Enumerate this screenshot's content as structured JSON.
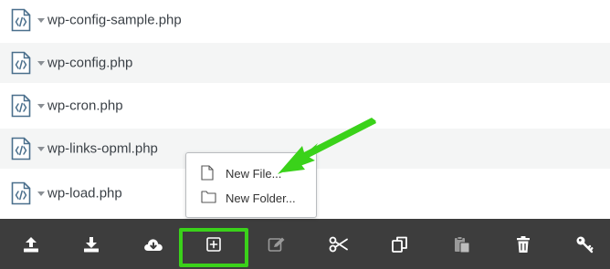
{
  "files": [
    {
      "name": "wp-config-sample.php",
      "icon": "php-file-icon"
    },
    {
      "name": "wp-config.php",
      "icon": "php-file-icon"
    },
    {
      "name": "wp-cron.php",
      "icon": "php-file-icon"
    },
    {
      "name": "wp-links-opml.php",
      "icon": "php-file-icon"
    },
    {
      "name": "wp-load.php",
      "icon": "php-file-icon"
    }
  ],
  "context_menu": {
    "new_file": "New File...",
    "new_folder": "New Folder..."
  },
  "toolbar": {
    "buttons": [
      "upload-icon",
      "download-icon",
      "cloud-download-icon",
      "new-item-icon",
      "edit-icon",
      "cut-icon",
      "copy-icon",
      "paste-icon",
      "trash-icon",
      "permissions-key-icon"
    ]
  },
  "colors": {
    "toolbar_bg": "#3d3d3d",
    "highlight": "#3ad21a",
    "icon_blue": "#4a6f8c",
    "row_alt": "#f4f5f5"
  }
}
